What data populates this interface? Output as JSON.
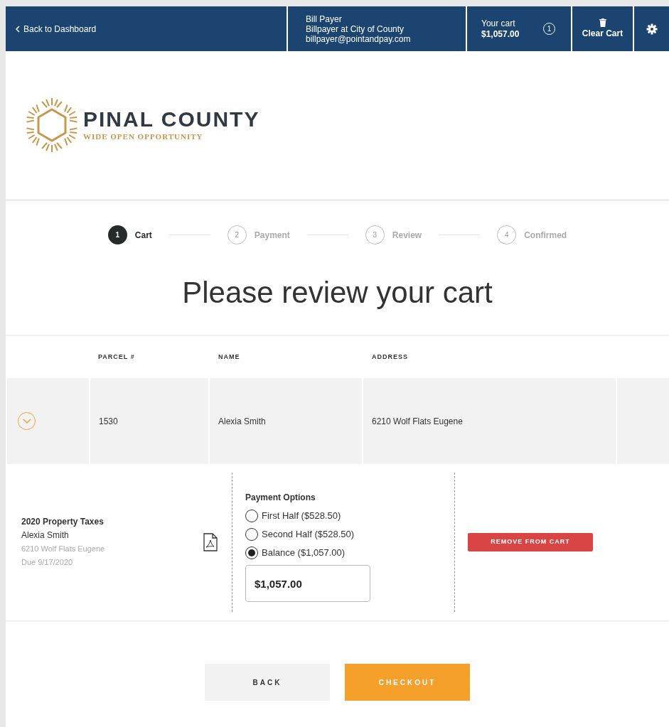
{
  "header": {
    "back_link": "Back to Dashboard",
    "user": {
      "name": "Bill Payer",
      "role": "Billpayer at City of County",
      "email": "billpayer@pointandpay.com"
    },
    "cart": {
      "label": "Your cart",
      "total": "$1,057.00",
      "count": "1"
    },
    "clear_cart": "Clear Cart"
  },
  "logo": {
    "name": "PINAL COUNTY",
    "tagline": "WIDE OPEN OPPORTUNITY"
  },
  "steps": [
    {
      "number": "1",
      "label": "Cart",
      "selected": true
    },
    {
      "number": "2",
      "label": "Payment",
      "selected": false
    },
    {
      "number": "3",
      "label": "Review",
      "selected": false
    },
    {
      "number": "4",
      "label": "Confirmed",
      "selected": false
    }
  ],
  "title": "Please review your cart",
  "table": {
    "columns": [
      "PARCEL #",
      "NAME",
      "ADDRESS"
    ],
    "rows": [
      {
        "expanded": true,
        "parcel": "1530",
        "name": "Alexia Smith",
        "address": "6210 Wolf Flats Eugene",
        "detail": {
          "title": "2020 Property Taxes",
          "owner": "Alexia Smith",
          "address": "6210 Wolf Flats Eugene",
          "due": "Due 9/17/2020",
          "options_label": "Payment Options",
          "options": [
            {
              "label": "First Half ($528.50)",
              "selected": false
            },
            {
              "label": "Second Half ($528.50)",
              "selected": false
            },
            {
              "label": "Balance ($1,057.00)",
              "selected": true
            }
          ],
          "amount": "$1,057.00",
          "remove": "REMOVE FROM CART"
        }
      }
    ]
  },
  "buttons": {
    "back": "BACK",
    "checkout": "CHECKOUT"
  }
}
